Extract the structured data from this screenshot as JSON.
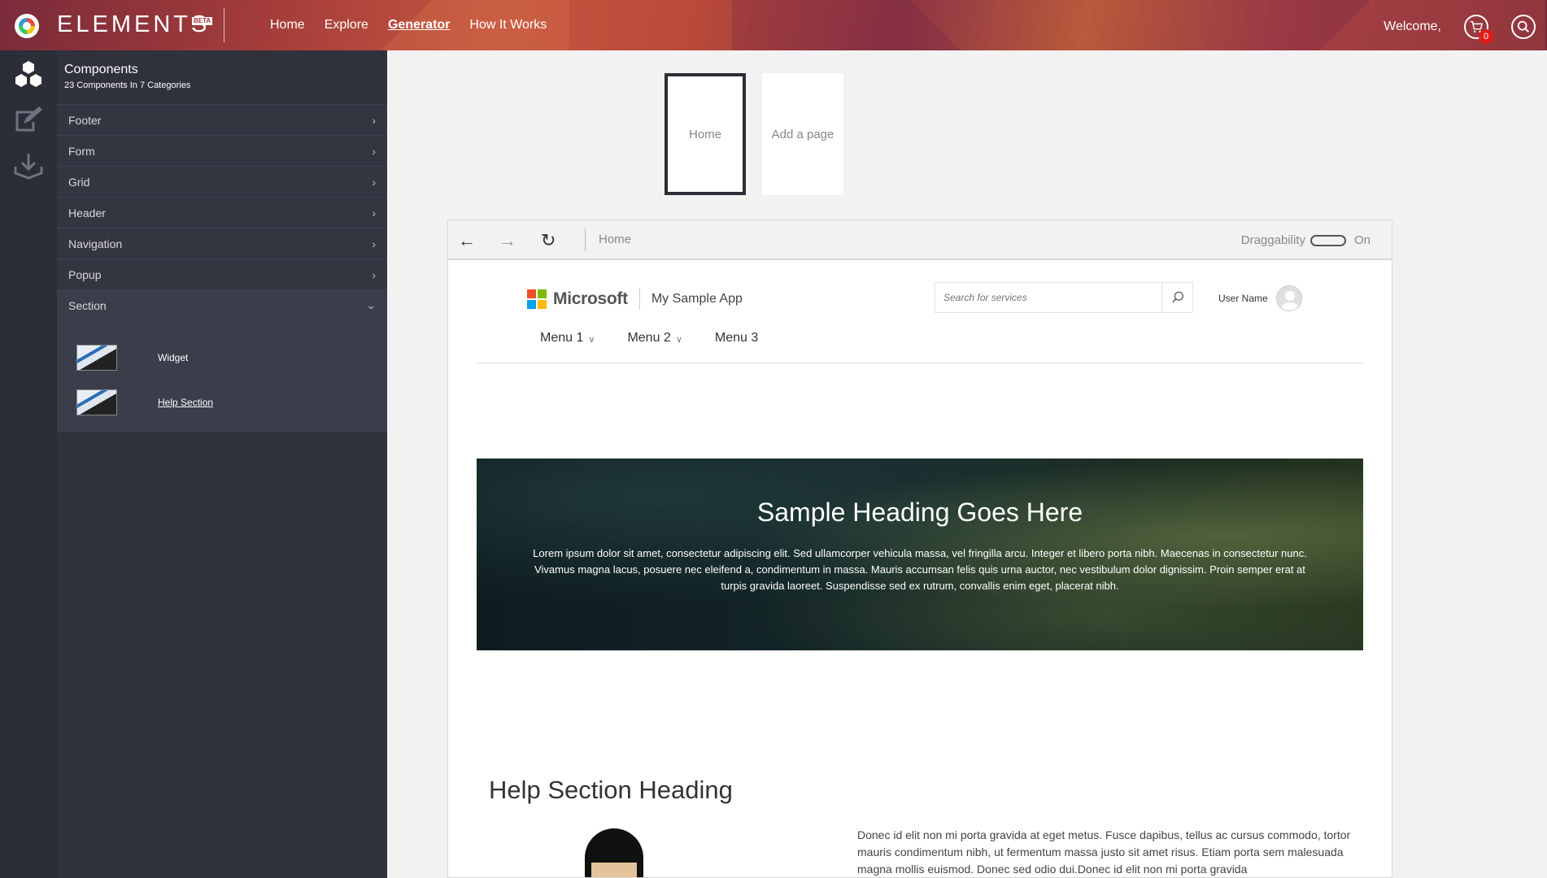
{
  "app": {
    "brand": "ELEMENTS",
    "beta": "BETA",
    "nav": [
      "Home",
      "Explore",
      "Generator",
      "How It Works"
    ],
    "active_nav": "Generator",
    "welcome": "Welcome,",
    "cart_count": "0"
  },
  "sidebar": {
    "title": "Components",
    "subtitle": "23 Components In 7 Categories",
    "categories": [
      "Footer",
      "Form",
      "Grid",
      "Header",
      "Navigation",
      "Popup",
      "Section"
    ],
    "open_category": "Section",
    "section_items": [
      "Widget",
      "Help Section"
    ]
  },
  "pages": {
    "tabs": [
      "Home",
      "Add a page"
    ]
  },
  "browser": {
    "address": "Home",
    "draggability_label": "Draggability",
    "draggability_state": "On"
  },
  "site": {
    "logo_text": "Microsoft",
    "app_name": "My Sample App",
    "search_placeholder": "Search for services",
    "user_name": "User Name",
    "menu": [
      "Menu 1",
      "Menu 2",
      "Menu 3"
    ],
    "hero": {
      "heading": "Sample Heading Goes Here",
      "body": "Lorem ipsum dolor sit amet, consectetur adipiscing elit. Sed ullamcorper vehicula massa, vel fringilla arcu. Integer et libero porta nibh. Maecenas in consectetur nunc. Vivamus magna lacus, posuere nec eleifend a, condimentum in massa. Mauris accumsan felis quis urna auctor, nec vestibulum dolor dignissim. Proin semper erat at turpis gravida laoreet. Suspendisse sed ex rutrum, convallis enim eget, placerat nibh."
    },
    "help": {
      "heading": "Help Section Heading",
      "body": "Donec id elit non mi porta gravida at eget metus. Fusce dapibus, tellus ac cursus commodo, tortor mauris condimentum nibh, ut fermentum massa justo sit amet risus. Etiam porta sem malesuada magna mollis euismod. Donec sed odio dui.Donec id elit non mi porta gravida"
    }
  },
  "colors": {
    "rail": "#2b2e36",
    "panel": "#2f323c",
    "cart_badge": "#e21b1b"
  }
}
